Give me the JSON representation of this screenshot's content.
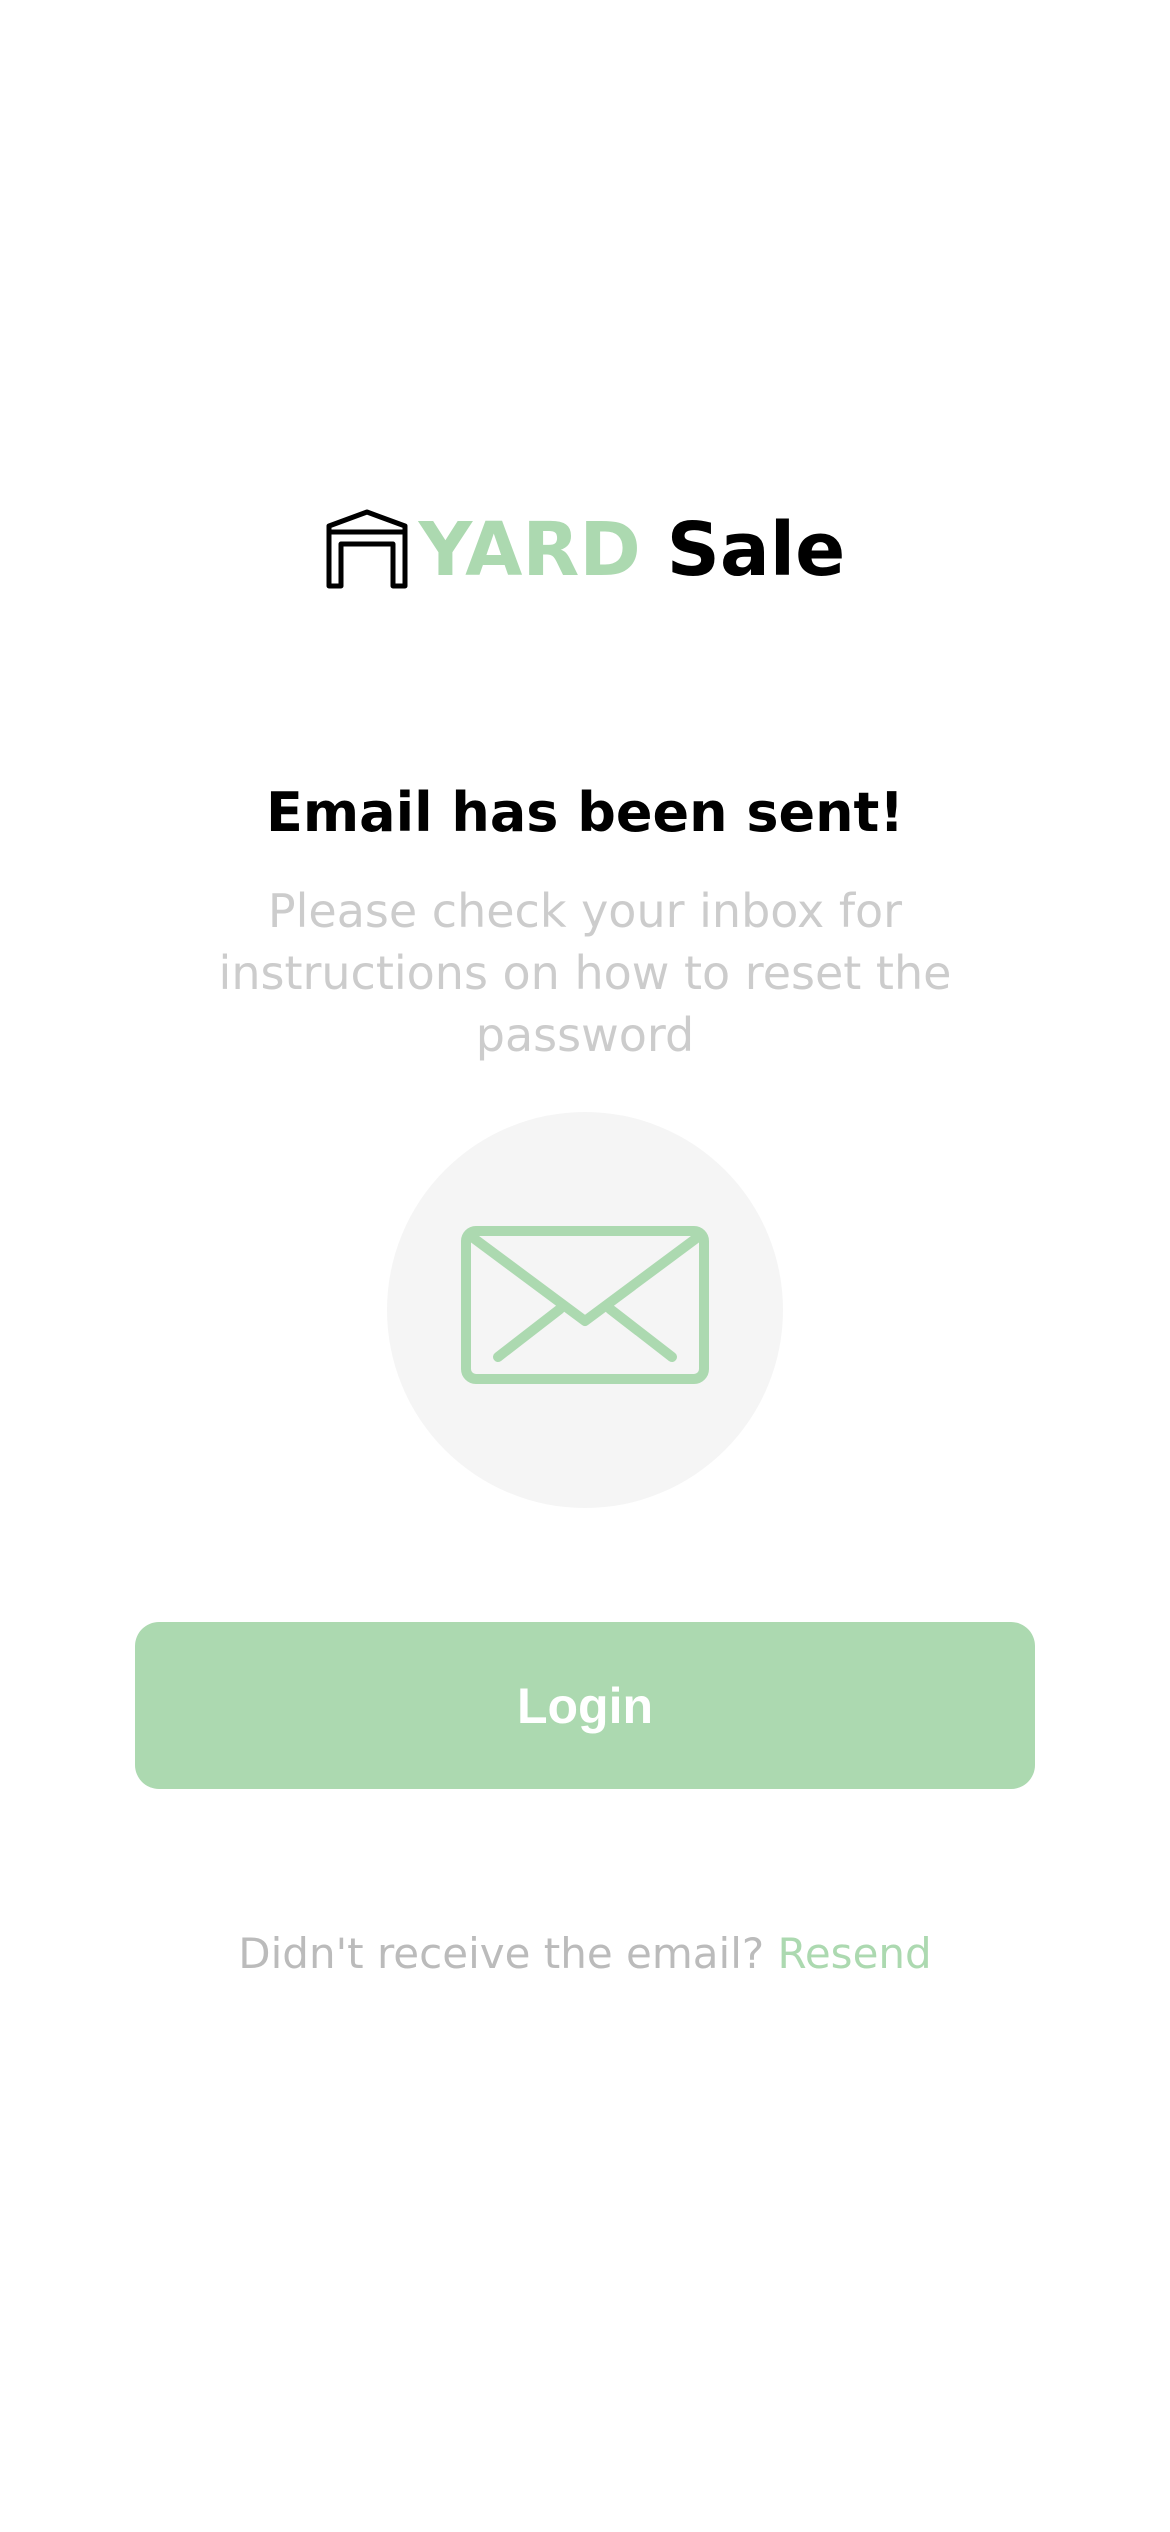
{
  "brand": {
    "icon": "garage-icon",
    "name_part1": "YARD",
    "name_part2": "Sale",
    "accent_color": "#acd9b0"
  },
  "main": {
    "title": "Email has been sent!",
    "subtitle": "Please check your inbox for instructions on how to reset the password",
    "illustration_icon": "envelope-icon"
  },
  "actions": {
    "login_label": "Login",
    "resend_prompt": "Didn't receive the email?",
    "resend_label": "Resend"
  }
}
